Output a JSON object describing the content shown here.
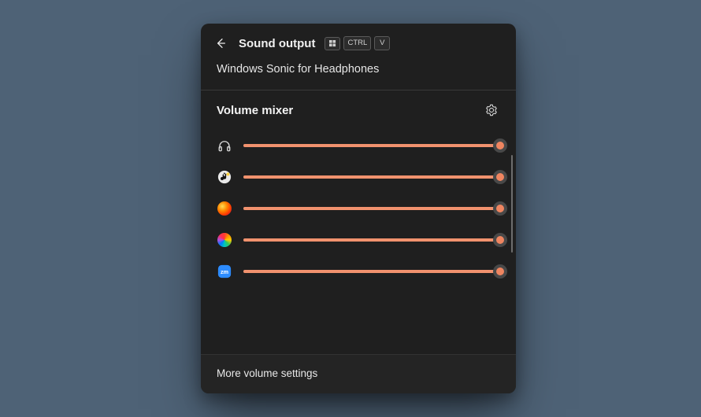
{
  "header": {
    "title": "Sound output",
    "shortcut": {
      "win": "win",
      "ctrl": "CTRL",
      "v": "V"
    }
  },
  "device_label": "Windows Sonic for Headphones",
  "mixer": {
    "title": "Volume mixer",
    "accent_color": "#f1926e",
    "items": [
      {
        "icon": "headphones",
        "name": "system-sounds",
        "level": 100
      },
      {
        "icon": "foobar",
        "name": "foobar2000",
        "level": 100
      },
      {
        "icon": "firefox",
        "name": "firefox",
        "level": 100
      },
      {
        "icon": "rainbow",
        "name": "photos",
        "level": 100
      },
      {
        "icon": "zoom",
        "name": "zoom",
        "level": 100
      }
    ]
  },
  "footer": {
    "more_label": "More volume settings"
  }
}
